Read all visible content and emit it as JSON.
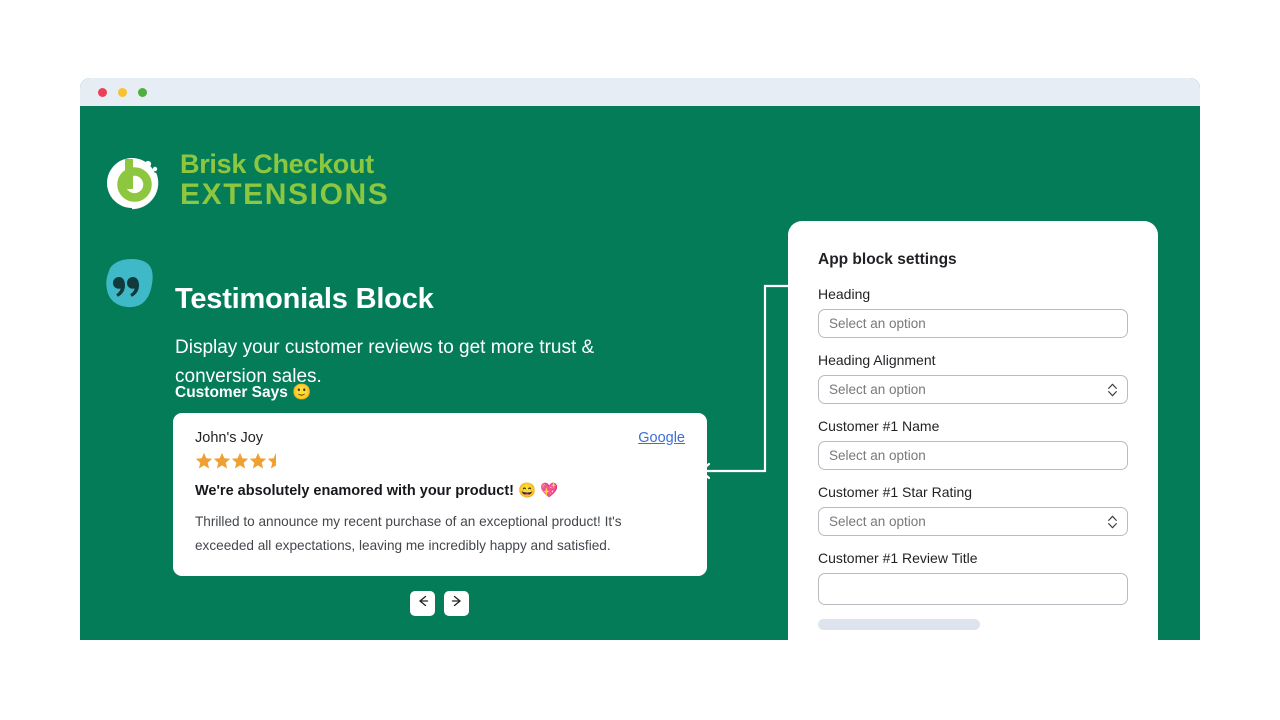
{
  "window": {
    "traffic_lights": [
      "red",
      "yellow",
      "green"
    ]
  },
  "brand": {
    "logo_icon": "brisk-b-logo-icon",
    "line1": "Brisk Checkout",
    "line2": "EXTENSIONS",
    "color": "#8DC63F"
  },
  "hero": {
    "quote_icon": "quote-marks-icon",
    "title": "Testimonials Block",
    "subtitle": "Display your customer reviews to get more trust & conversion sales.",
    "customer_says_label": "Customer Says 🙂"
  },
  "review_card": {
    "reviewer_name": "John's Joy",
    "source_label": "Google",
    "source_color": "#3D6FD4",
    "rating": 4.5,
    "max_rating": 5,
    "star_color": "#F0A030",
    "title": "We're absolutely enamored with your product! 😄 💖",
    "body": "Thrilled to announce my recent purchase of an exceptional product! It's exceeded all expectations, leaving me incredibly happy and satisfied."
  },
  "carousel": {
    "prev_icon": "arrow-left-icon",
    "next_icon": "arrow-right-icon",
    "prev_label": "←",
    "next_label": "→"
  },
  "connector": {
    "arrow_icon": "arrow-left-callout-icon"
  },
  "settings_panel": {
    "title": "App block settings",
    "fields": [
      {
        "label": "Heading",
        "placeholder": "Select an option",
        "type": "text",
        "value": ""
      },
      {
        "label": "Heading Alignment",
        "placeholder": "Select an option",
        "type": "select",
        "value": ""
      },
      {
        "label": "Customer #1 Name",
        "placeholder": "Select an option",
        "type": "text",
        "value": ""
      },
      {
        "label": "Customer #1 Star Rating",
        "placeholder": "Select an option",
        "type": "select",
        "value": ""
      },
      {
        "label": "Customer #1 Review Title",
        "placeholder": "",
        "type": "text",
        "value": ""
      }
    ],
    "stepper_icon": "chevron-up-down-icon",
    "skeleton_placeholder": ""
  },
  "theme": {
    "background_green": "#047C57",
    "titlebar": "#E7EDF4",
    "card_white": "#FFFFFF",
    "skeleton": "#DDE4EE"
  }
}
